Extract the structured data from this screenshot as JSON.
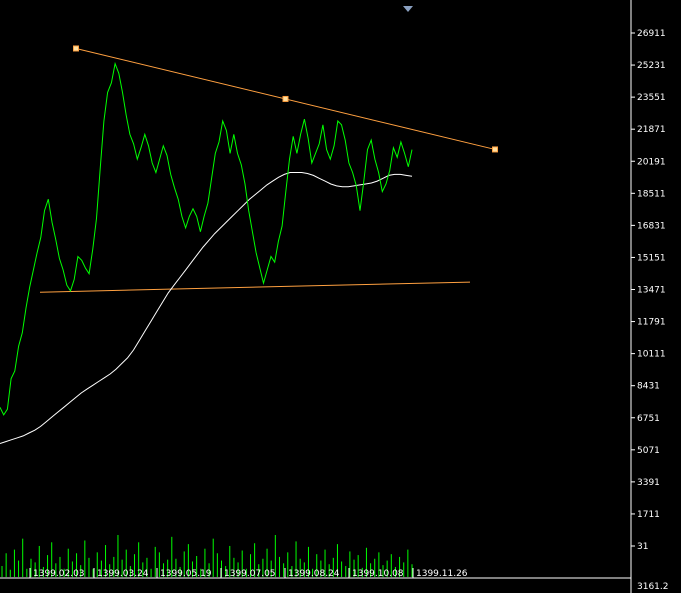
{
  "colors": {
    "background": "#000000",
    "axis": "#ffffff",
    "price_line": "#00ff00",
    "ma_line": "#ffffff",
    "trendline": "#ffa040",
    "trendline_handle": "#ffe0a0",
    "volume": "#00ff00",
    "scroll_marker": "#8aa0c0"
  },
  "chart_data": {
    "type": "line",
    "y_axis_labels": [
      "26911",
      "25231",
      "23551",
      "21871",
      "20191",
      "18511",
      "16831",
      "15151",
      "13471",
      "11791",
      "10111",
      "8431",
      "6751",
      "5071",
      "3391",
      "1711",
      "31"
    ],
    "volume_axis_label": "3161.2",
    "x_axis_labels": [
      "1399.02.03",
      "1399.03.24",
      "1399.05.19",
      "1399.07.05",
      "1399.08.24",
      "1399.10.08",
      "1399.11.26"
    ],
    "ylim": [
      31,
      26911
    ],
    "series": [
      {
        "values": [
          7300,
          6900,
          7200,
          8800,
          9200,
          10500,
          11200,
          12500,
          13600,
          14500,
          15400,
          16200,
          17600,
          18200,
          17000,
          16100,
          15100,
          14500,
          13700,
          13400,
          14000,
          15200,
          15000,
          14600,
          14300,
          15600,
          17200,
          19800,
          22300,
          23800,
          24300,
          25300,
          24800,
          23800,
          22600,
          21600,
          21100,
          20300,
          20900,
          21600,
          21000,
          20100,
          19600,
          20300,
          21000,
          20500,
          19500,
          18800,
          18200,
          17300,
          16700,
          17300,
          17700,
          17300,
          16500,
          17300,
          18000,
          19300,
          20600,
          21200,
          22300,
          21800,
          20600,
          21600,
          20600,
          20000,
          19000,
          17600,
          16500,
          15400,
          14600,
          13800,
          14500,
          15200,
          14900,
          16000,
          16800,
          18600,
          20300,
          21500,
          20600,
          21600,
          22400,
          21400,
          20100,
          20600,
          21100,
          22100,
          20800,
          20300,
          21000,
          22300,
          22100,
          21300,
          20100,
          19600,
          18900,
          17600,
          19100,
          20800,
          21300,
          20300,
          19600,
          18600,
          19000,
          19700,
          20900,
          20400,
          21200,
          20600,
          19900,
          20800
        ]
      },
      {
        "values": [
          5400,
          5500,
          5600,
          5700,
          5800,
          5950,
          6100,
          6300,
          6550,
          6800,
          7050,
          7300,
          7550,
          7800,
          8050,
          8250,
          8450,
          8650,
          8850,
          9050,
          9300,
          9600,
          9900,
          10300,
          10800,
          11300,
          11800,
          12300,
          12800,
          13300,
          13700,
          14100,
          14500,
          14900,
          15300,
          15700,
          16050,
          16400,
          16700,
          17000,
          17300,
          17600,
          17900,
          18200,
          18450,
          18700,
          18950,
          19150,
          19350,
          19500,
          19600,
          19600,
          19600,
          19550,
          19450,
          19300,
          19150,
          19000,
          18900,
          18850,
          18850,
          18900,
          18950,
          19000,
          19050,
          19150,
          19300,
          19450,
          19500,
          19500,
          19450,
          19400
        ]
      }
    ],
    "trendlines": [
      {
        "points": [
          [
            0,
            26100
          ],
          [
            1,
            20810
          ]
        ]
      },
      {
        "points": [
          [
            0,
            13330
          ],
          [
            1,
            13860
          ]
        ]
      }
    ],
    "volume": [
      120,
      260,
      80,
      300,
      180,
      420,
      90,
      200,
      160,
      340,
      110,
      240,
      380,
      150,
      220,
      90,
      310,
      170,
      260,
      130,
      400,
      210,
      90,
      270,
      180,
      350,
      140,
      220,
      460,
      190,
      300,
      120,
      250,
      380,
      160,
      210,
      90,
      330,
      270,
      150,
      190,
      440,
      200,
      110,
      280,
      360,
      170,
      230,
      90,
      310,
      150,
      420,
      260,
      180,
      120,
      340,
      210,
      160,
      290,
      90,
      250,
      370,
      140,
      200,
      310,
      180,
      460,
      220,
      150,
      270,
      120,
      390,
      200,
      160,
      330,
      90,
      250,
      180,
      300,
      140,
      210,
      360,
      170,
      120,
      280,
      190,
      240,
      100,
      320,
      150,
      200,
      270,
      130,
      180,
      250,
      110,
      220,
      160,
      300,
      140
    ]
  }
}
